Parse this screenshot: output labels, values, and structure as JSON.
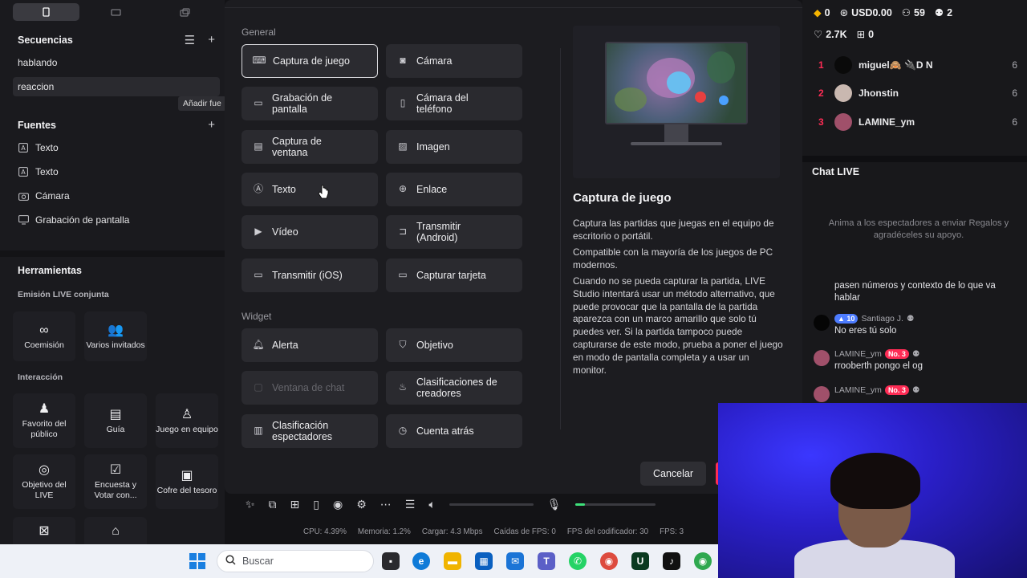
{
  "left": {
    "scenes_title": "Secuencias",
    "scenes": [
      "hablando",
      "reaccion"
    ],
    "tooltip": "Añadir fue",
    "sources_title": "Fuentes",
    "sources": [
      {
        "label": "Texto",
        "icon": "text-icon"
      },
      {
        "label": "Texto",
        "icon": "text-icon"
      },
      {
        "label": "Cámara",
        "icon": "camera-icon"
      },
      {
        "label": "Grabación de pantalla",
        "icon": "monitor-icon"
      }
    ],
    "tools_title": "Herramientas",
    "collab_title": "Emisión LIVE conjunta",
    "collab_tools": [
      {
        "label": "Coemisión",
        "icon": "link-icon"
      },
      {
        "label": "Varios invitados",
        "icon": "users-icon"
      }
    ],
    "interaction_title": "Interacción",
    "interaction_tools": [
      {
        "label": "Favorito del público",
        "icon": "audience-icon"
      },
      {
        "label": "Guía",
        "icon": "guide-icon"
      },
      {
        "label": "Juego en equipo",
        "icon": "team-icon"
      },
      {
        "label": "Objetivo del LIVE",
        "icon": "goal-icon"
      },
      {
        "label": "Encuesta y Votar con...",
        "icon": "poll-icon"
      },
      {
        "label": "Cofre del tesoro",
        "icon": "chest-icon"
      }
    ]
  },
  "dialog": {
    "general_label": "General",
    "widget_label": "Widget",
    "general_options": [
      {
        "label": "Captura de juego",
        "icon": "gamepad-icon",
        "selected": true
      },
      {
        "label": "Cámara",
        "icon": "camera-icon"
      },
      {
        "label": "Grabación de pantalla",
        "icon": "monitor-icon"
      },
      {
        "label": "Cámara del teléfono",
        "icon": "phone-camera-icon"
      },
      {
        "label": "Captura de ventana",
        "icon": "window-icon"
      },
      {
        "label": "Imagen",
        "icon": "image-icon"
      },
      {
        "label": "Texto",
        "icon": "text-icon"
      },
      {
        "label": "Enlace",
        "icon": "globe-icon"
      },
      {
        "label": "Vídeo",
        "icon": "play-icon"
      },
      {
        "label": "Transmitir (Android)",
        "icon": "cast-icon"
      },
      {
        "label": "Transmitir (iOS)",
        "icon": "screen-cast-icon"
      },
      {
        "label": "Capturar tarjeta",
        "icon": "card-icon"
      }
    ],
    "widget_options": [
      {
        "label": "Alerta",
        "icon": "bell-icon"
      },
      {
        "label": "Objetivo",
        "icon": "shield-icon"
      },
      {
        "label": "Ventana de chat",
        "icon": "chat-icon",
        "disabled": true
      },
      {
        "label": "Clasificaciones de creadores",
        "icon": "trophy-icon"
      },
      {
        "label": "Clasificación espectadores",
        "icon": "podium-icon"
      },
      {
        "label": "Cuenta atrás",
        "icon": "timer-icon"
      }
    ],
    "detail_title": "Captura de juego",
    "detail_p1": "Captura las partidas que juegas en el equipo de escritorio o portátil.",
    "detail_p2": "Compatible con la mayoría de los juegos de PC modernos.",
    "detail_p3": "Cuando no se pueda capturar la partida, LIVE Studio intentará usar un método alternativo, que puede provocar que la pantalla de la partida aparezca con un marco amarillo que solo tú puedes ver. Si la partida tampoco puede capturarse de este modo, prueba a poner el juego en modo de pantalla completa y a usar un monitor.",
    "cancel_label": "Cancelar"
  },
  "statusbar": {
    "cpu": "CPU: 4.39%",
    "memory": "Memoria: 1.2%",
    "load": "Cargar: 4.3 Mbps",
    "fps_drops": "Caídas de FPS: 0",
    "encoder_fps": "FPS del codificador: 30",
    "fps": "FPS: 3",
    "mic_level": 0.12
  },
  "right": {
    "coins": "0",
    "usd": "USD0.00",
    "viewers": "59",
    "guests": "2",
    "likes": "2.7K",
    "gifts": "0",
    "ranking": [
      {
        "rank": "1",
        "name": "miguel🙈 🔌D N",
        "score": "6",
        "color": "#111111"
      },
      {
        "rank": "2",
        "name": "Jhonstin",
        "score": "6",
        "color": "#c9b8b0"
      },
      {
        "rank": "3",
        "name": "LAMINE_ym",
        "score": "6",
        "color": "#a0506a"
      }
    ],
    "chat_title": "Chat LIVE",
    "chat_hint": "Anima a los espectadores a enviar Regalos y agradéceles su apoyo.",
    "messages": [
      {
        "user": "",
        "text": "pasen números y contexto de lo que va hablar"
      },
      {
        "user": "Santiago J.",
        "badge": "10",
        "badge_type": "blue",
        "text": "No eres tú solo"
      },
      {
        "user": "LAMINE_ym",
        "badge": "No. 3",
        "badge_type": "red",
        "text": "rrooberth pongo el og"
      },
      {
        "user": "LAMINE_ym",
        "badge": "No. 3",
        "badge_type": "red",
        "text": ""
      }
    ]
  },
  "taskbar": {
    "search_placeholder": "Buscar"
  }
}
